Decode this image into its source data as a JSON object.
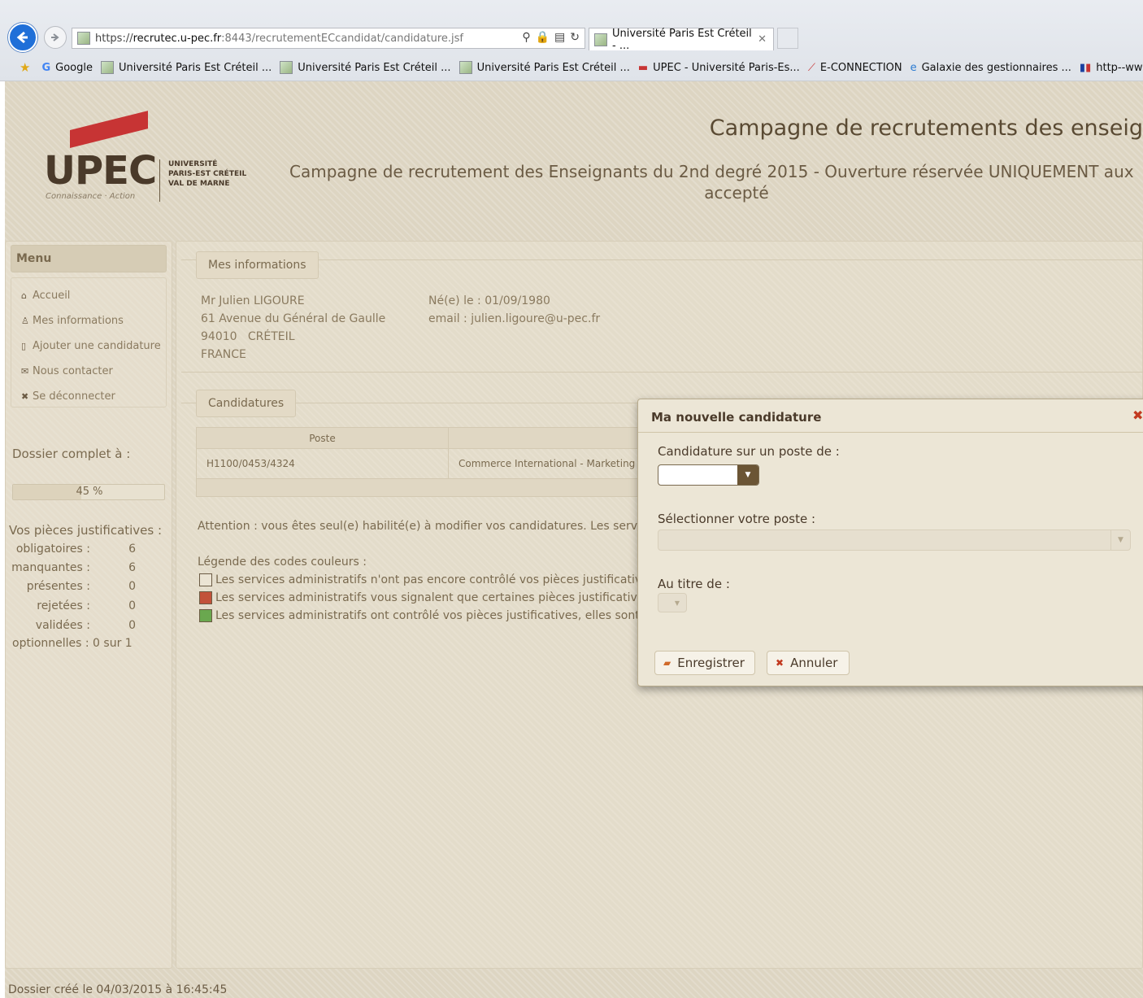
{
  "browser": {
    "url_protocol": "https://",
    "url_host": "recrutec.u-pec.fr",
    "url_path": ":8443/recrutementECcandidat/candidature.jsf",
    "tab_title": "Université Paris Est Créteil - ...",
    "favorites": [
      "Google",
      "Université Paris Est Créteil ...",
      "Université Paris Est Créteil ...",
      "Université Paris Est Créteil ...",
      "UPEC - Université Paris-Es...",
      "E-CONNECTION",
      "Galaxie des gestionnaires ...",
      "http--www.legifrance"
    ]
  },
  "header": {
    "logo_text": "UPEC",
    "logo_tagline": "Connaissance · Action",
    "logo_university": [
      "UNIVERSITÉ",
      "PARIS-EST CRÉTEIL",
      "VAL DE MARNE"
    ],
    "title": "Campagne de recrutements des enseig",
    "subtitle_line1": "Campagne de recrutement des Enseignants du 2nd degré 2015 - Ouverture réservée UNIQUEMENT aux",
    "subtitle_line2": "accepté"
  },
  "menu": {
    "title": "Menu",
    "items": [
      {
        "icon": "home-icon",
        "label": "Accueil"
      },
      {
        "icon": "user-icon",
        "label": "Mes informations"
      },
      {
        "icon": "document-icon",
        "label": "Ajouter une candidature"
      },
      {
        "icon": "mail-icon",
        "label": "Nous contacter"
      },
      {
        "icon": "close-icon",
        "label": "Se déconnecter"
      }
    ]
  },
  "dossier": {
    "label": "Dossier complet à :",
    "progress_percent": 45,
    "progress_text": "45 %"
  },
  "pieces": {
    "title": "Vos pièces justificatives :",
    "rows": [
      {
        "label": "obligatoires :",
        "value": "6"
      },
      {
        "label": "manquantes :",
        "value": "6"
      },
      {
        "label": "présentes :",
        "value": "0"
      },
      {
        "label": "rejetées :",
        "value": "0"
      },
      {
        "label": "validées :",
        "value": "0"
      }
    ],
    "optionnelles": "optionnelles : 0 sur 1"
  },
  "infos": {
    "legend": "Mes informations",
    "name": "Mr Julien LIGOURE",
    "address": "61 Avenue du Général de Gaulle",
    "city": "94010   CRÉTEIL",
    "country": "FRANCE",
    "birth": "Né(e) le : 01/09/1980",
    "email": "email : julien.ligoure@u-pec.fr"
  },
  "candidatures": {
    "legend": "Candidatures",
    "col_poste": "Poste",
    "row_poste": "H1100/0453/4324",
    "row_domaine": "Commerce International - Marketing"
  },
  "notes": {
    "attention": "Attention : vous êtes seul(e) habilité(e) à modifier vos candidatures. Les services",
    "legend_title": "Légende des codes couleurs :",
    "legend_rows": [
      {
        "color": "#ebe4d4",
        "text": "Les services administratifs n'ont pas encore contrôlé vos pièces justificatives,"
      },
      {
        "color": "#c2523a",
        "text": "Les services administratifs vous signalent que certaines pièces justificatives n"
      },
      {
        "color": "#6aa84f",
        "text": "Les services administratifs ont contrôlé vos pièces justificatives, elles sont co"
      }
    ]
  },
  "footer": {
    "text": "Dossier créé le 04/03/2015 à 16:45:45"
  },
  "dialog": {
    "title": "Ma nouvelle candidature",
    "field1_label": "Candidature sur un poste de :",
    "field2_label": "Sélectionner votre poste :",
    "field3_label": "Au titre de :",
    "save_label": "Enregistrer",
    "cancel_label": "Annuler"
  }
}
